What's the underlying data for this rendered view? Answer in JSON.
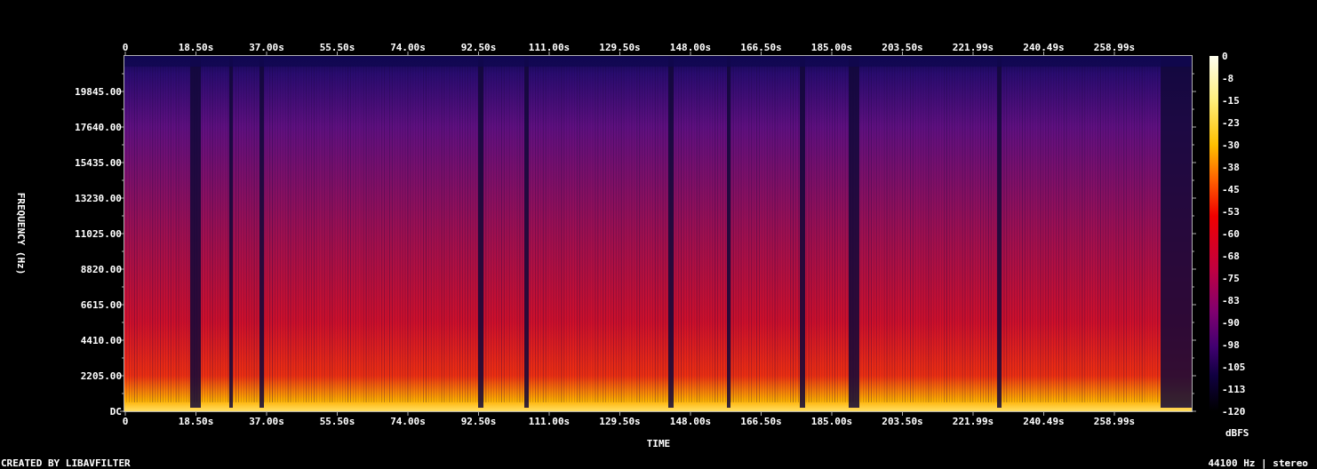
{
  "spectrogram": {
    "top_time_ticks": [
      "0",
      "18.50s",
      "37.00s",
      "55.50s",
      "74.00s",
      "92.50s",
      "111.00s",
      "129.50s",
      "148.00s",
      "166.50s",
      "185.00s",
      "203.50s",
      "221.99s",
      "240.49s",
      "258.99s"
    ],
    "frequency_ticks": [
      "19845.00",
      "17640.00",
      "15435.00",
      "13230.00",
      "11025.00",
      "8820.00",
      "6615.00",
      "4410.00",
      "2205.00",
      "DC"
    ],
    "bottom_time_ticks": [
      "0",
      "18.50s",
      "37.00s",
      "55.50s",
      "74.00s",
      "92.50s",
      "111.00s",
      "129.50s",
      "148.00s",
      "166.50s",
      "185.00s",
      "203.50s",
      "221.99s",
      "240.49s",
      "258.99s"
    ],
    "x_axis_label": "TIME",
    "y_axis_label": "FREQUENCY (Hz)"
  },
  "color_scale": {
    "ticks": [
      "0",
      "-8",
      "-15",
      "-23",
      "-30",
      "-38",
      "-45",
      "-53",
      "-60",
      "-68",
      "-75",
      "-83",
      "-90",
      "-98",
      "-105",
      "-113",
      "-120"
    ],
    "unit": "dBFS"
  },
  "footer": {
    "credit": "CREATED BY LIBAVFILTER",
    "format": "44100 Hz | stereo"
  }
}
